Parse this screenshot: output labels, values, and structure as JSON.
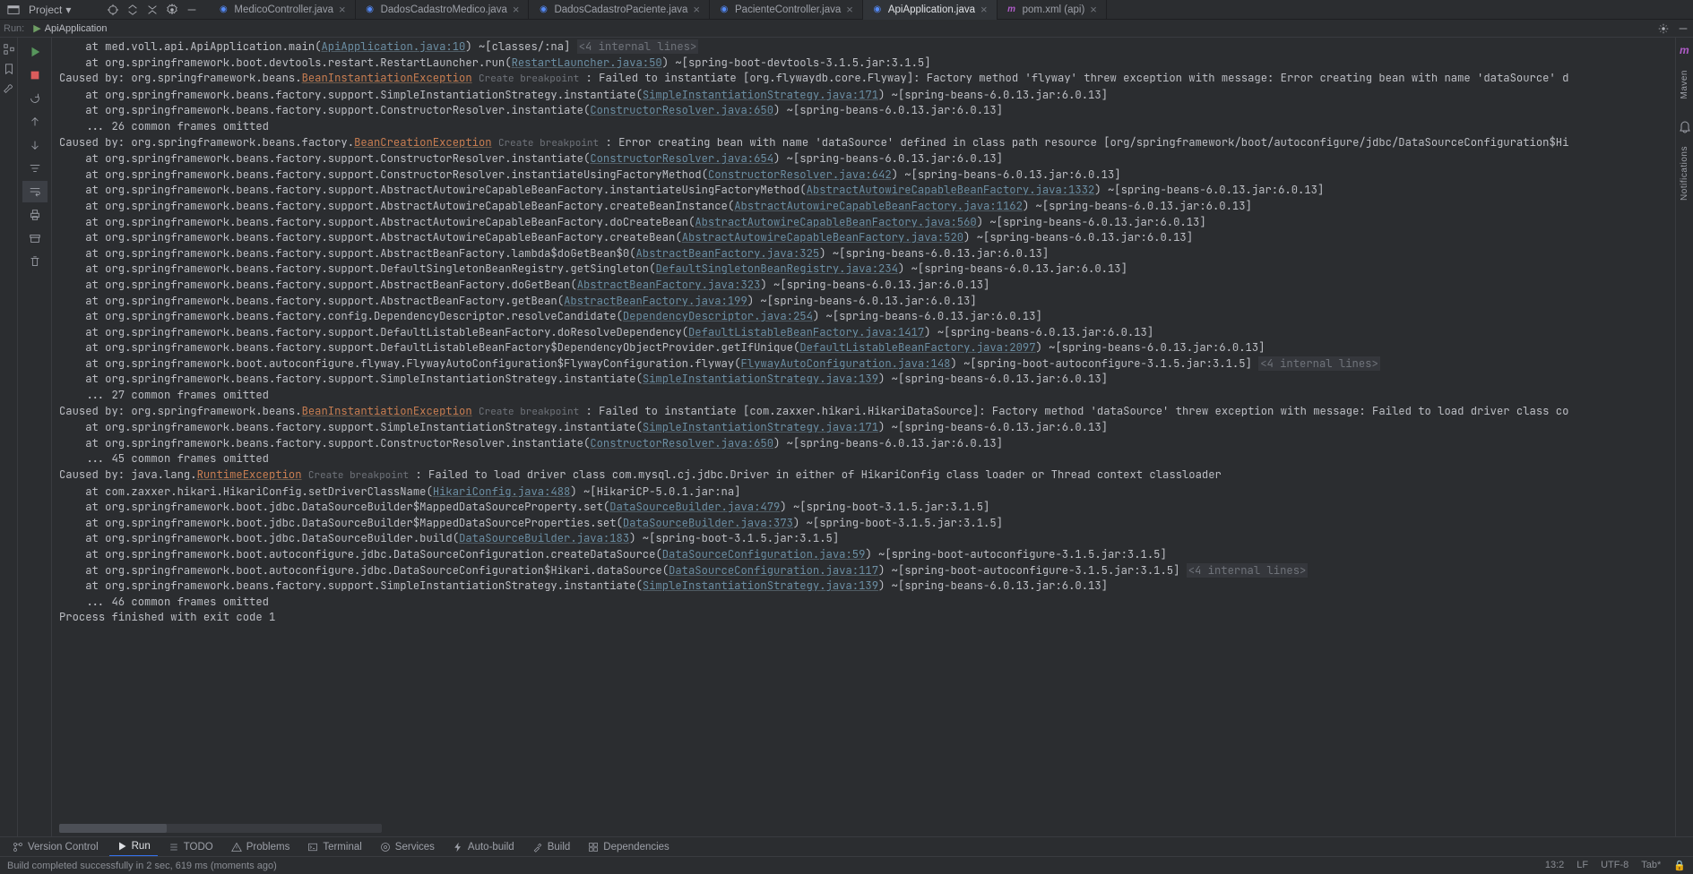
{
  "project_label": "Project",
  "tabs": [
    {
      "label": "MedicoController.java",
      "active": false,
      "icon": "j"
    },
    {
      "label": "DadosCadastroMedico.java",
      "active": false,
      "icon": "j"
    },
    {
      "label": "DadosCadastroPaciente.java",
      "active": false,
      "icon": "j"
    },
    {
      "label": "PacienteController.java",
      "active": false,
      "icon": "j"
    },
    {
      "label": "ApiApplication.java",
      "active": true,
      "icon": "j"
    },
    {
      "label": "pom.xml (api)",
      "active": false,
      "icon": "m"
    }
  ],
  "run_label": "Run:",
  "run_config": "ApiApplication",
  "right_rail": {
    "maven": "Maven",
    "notifications": "Notifications"
  },
  "bottom_tabs": [
    {
      "label": "Version Control",
      "icon": "branch"
    },
    {
      "label": "Run",
      "icon": "play",
      "active": true
    },
    {
      "label": "TODO",
      "icon": "list"
    },
    {
      "label": "Problems",
      "icon": "warn"
    },
    {
      "label": "Terminal",
      "icon": "term"
    },
    {
      "label": "Services",
      "icon": "gear"
    },
    {
      "label": "Auto-build",
      "icon": "bolt"
    },
    {
      "label": "Build",
      "icon": "hammer"
    },
    {
      "label": "Dependencies",
      "icon": "deps"
    }
  ],
  "status": {
    "left": "Build completed successfully in 2 sec, 619 ms (moments ago)",
    "pos": "13:2",
    "lf": "LF",
    "enc": "UTF-8",
    "tab": "Tab*"
  },
  "console_lines": [
    {
      "parts": [
        {
          "t": "    at med.voll.api.ApiApplication.main("
        },
        {
          "t": "ApiApplication.java:10",
          "cls": "lnk"
        },
        {
          "t": ") ~[classes/:na] "
        },
        {
          "t": "<4 internal lines>",
          "cls": "dim"
        }
      ]
    },
    {
      "parts": [
        {
          "t": "    at org.springframework.boot.devtools.restart.RestartLauncher.run("
        },
        {
          "t": "RestartLauncher.java:50",
          "cls": "lnk"
        },
        {
          "t": ") ~[spring-boot-devtools-3.1.5.jar:3.1.5]"
        }
      ]
    },
    {
      "parts": [
        {
          "t": "Caused by: org.springframework.beans."
        },
        {
          "t": "BeanInstantiationException",
          "cls": "exc"
        },
        {
          "t": " "
        },
        {
          "t": "Create breakpoint",
          "cls": "bp"
        },
        {
          "t": " : Failed to instantiate [org.flywaydb.core.Flyway]: Factory method 'flyway' threw exception with message: Error creating bean with name 'dataSource' d"
        }
      ]
    },
    {
      "parts": [
        {
          "t": "    at org.springframework.beans.factory.support.SimpleInstantiationStrategy.instantiate("
        },
        {
          "t": "SimpleInstantiationStrategy.java:171",
          "cls": "lnk"
        },
        {
          "t": ") ~[spring-beans-6.0.13.jar:6.0.13]"
        }
      ]
    },
    {
      "parts": [
        {
          "t": "    at org.springframework.beans.factory.support.ConstructorResolver.instantiate("
        },
        {
          "t": "ConstructorResolver.java:650",
          "cls": "lnk"
        },
        {
          "t": ") ~[spring-beans-6.0.13.jar:6.0.13]"
        }
      ]
    },
    {
      "parts": [
        {
          "t": "    ... 26 common frames omitted"
        }
      ]
    },
    {
      "parts": [
        {
          "t": "Caused by: org.springframework.beans.factory."
        },
        {
          "t": "BeanCreationException",
          "cls": "exc"
        },
        {
          "t": " "
        },
        {
          "t": "Create breakpoint",
          "cls": "bp"
        },
        {
          "t": " : Error creating bean with name 'dataSource' defined in class path resource [org/springframework/boot/autoconfigure/jdbc/DataSourceConfiguration$Hi"
        }
      ]
    },
    {
      "parts": [
        {
          "t": "    at org.springframework.beans.factory.support.ConstructorResolver.instantiate("
        },
        {
          "t": "ConstructorResolver.java:654",
          "cls": "lnk"
        },
        {
          "t": ") ~[spring-beans-6.0.13.jar:6.0.13]"
        }
      ]
    },
    {
      "parts": [
        {
          "t": "    at org.springframework.beans.factory.support.ConstructorResolver.instantiateUsingFactoryMethod("
        },
        {
          "t": "ConstructorResolver.java:642",
          "cls": "lnk"
        },
        {
          "t": ") ~[spring-beans-6.0.13.jar:6.0.13]"
        }
      ]
    },
    {
      "parts": [
        {
          "t": "    at org.springframework.beans.factory.support.AbstractAutowireCapableBeanFactory.instantiateUsingFactoryMethod("
        },
        {
          "t": "AbstractAutowireCapableBeanFactory.java:1332",
          "cls": "lnk"
        },
        {
          "t": ") ~[spring-beans-6.0.13.jar:6.0.13]"
        }
      ]
    },
    {
      "parts": [
        {
          "t": "    at org.springframework.beans.factory.support.AbstractAutowireCapableBeanFactory.createBeanInstance("
        },
        {
          "t": "AbstractAutowireCapableBeanFactory.java:1162",
          "cls": "lnk"
        },
        {
          "t": ") ~[spring-beans-6.0.13.jar:6.0.13]"
        }
      ]
    },
    {
      "parts": [
        {
          "t": "    at org.springframework.beans.factory.support.AbstractAutowireCapableBeanFactory.doCreateBean("
        },
        {
          "t": "AbstractAutowireCapableBeanFactory.java:560",
          "cls": "lnk"
        },
        {
          "t": ") ~[spring-beans-6.0.13.jar:6.0.13]"
        }
      ]
    },
    {
      "parts": [
        {
          "t": "    at org.springframework.beans.factory.support.AbstractAutowireCapableBeanFactory.createBean("
        },
        {
          "t": "AbstractAutowireCapableBeanFactory.java:520",
          "cls": "lnk"
        },
        {
          "t": ") ~[spring-beans-6.0.13.jar:6.0.13]"
        }
      ]
    },
    {
      "parts": [
        {
          "t": "    at org.springframework.beans.factory.support.AbstractBeanFactory.lambda$doGetBean$0("
        },
        {
          "t": "AbstractBeanFactory.java:325",
          "cls": "lnk"
        },
        {
          "t": ") ~[spring-beans-6.0.13.jar:6.0.13]"
        }
      ]
    },
    {
      "parts": [
        {
          "t": "    at org.springframework.beans.factory.support.DefaultSingletonBeanRegistry.getSingleton("
        },
        {
          "t": "DefaultSingletonBeanRegistry.java:234",
          "cls": "lnk"
        },
        {
          "t": ") ~[spring-beans-6.0.13.jar:6.0.13]"
        }
      ]
    },
    {
      "parts": [
        {
          "t": "    at org.springframework.beans.factory.support.AbstractBeanFactory.doGetBean("
        },
        {
          "t": "AbstractBeanFactory.java:323",
          "cls": "lnk"
        },
        {
          "t": ") ~[spring-beans-6.0.13.jar:6.0.13]"
        }
      ]
    },
    {
      "parts": [
        {
          "t": "    at org.springframework.beans.factory.support.AbstractBeanFactory.getBean("
        },
        {
          "t": "AbstractBeanFactory.java:199",
          "cls": "lnk"
        },
        {
          "t": ") ~[spring-beans-6.0.13.jar:6.0.13]"
        }
      ]
    },
    {
      "parts": [
        {
          "t": "    at org.springframework.beans.factory.config.DependencyDescriptor.resolveCandidate("
        },
        {
          "t": "DependencyDescriptor.java:254",
          "cls": "lnk"
        },
        {
          "t": ") ~[spring-beans-6.0.13.jar:6.0.13]"
        }
      ]
    },
    {
      "parts": [
        {
          "t": "    at org.springframework.beans.factory.support.DefaultListableBeanFactory.doResolveDependency("
        },
        {
          "t": "DefaultListableBeanFactory.java:1417",
          "cls": "lnk"
        },
        {
          "t": ") ~[spring-beans-6.0.13.jar:6.0.13]"
        }
      ]
    },
    {
      "parts": [
        {
          "t": "    at org.springframework.beans.factory.support.DefaultListableBeanFactory$DependencyObjectProvider.getIfUnique("
        },
        {
          "t": "DefaultListableBeanFactory.java:2097",
          "cls": "lnk"
        },
        {
          "t": ") ~[spring-beans-6.0.13.jar:6.0.13]"
        }
      ]
    },
    {
      "parts": [
        {
          "t": "    at org.springframework.boot.autoconfigure.flyway.FlywayAutoConfiguration$FlywayConfiguration.flyway("
        },
        {
          "t": "FlywayAutoConfiguration.java:148",
          "cls": "lnk"
        },
        {
          "t": ") ~[spring-boot-autoconfigure-3.1.5.jar:3.1.5] "
        },
        {
          "t": "<4 internal lines>",
          "cls": "dim"
        }
      ]
    },
    {
      "parts": [
        {
          "t": "    at org.springframework.beans.factory.support.SimpleInstantiationStrategy.instantiate("
        },
        {
          "t": "SimpleInstantiationStrategy.java:139",
          "cls": "lnk"
        },
        {
          "t": ") ~[spring-beans-6.0.13.jar:6.0.13]"
        }
      ]
    },
    {
      "parts": [
        {
          "t": "    ... 27 common frames omitted"
        }
      ]
    },
    {
      "parts": [
        {
          "t": "Caused by: org.springframework.beans."
        },
        {
          "t": "BeanInstantiationException",
          "cls": "exc"
        },
        {
          "t": " "
        },
        {
          "t": "Create breakpoint",
          "cls": "bp"
        },
        {
          "t": " : Failed to instantiate [com.zaxxer.hikari.HikariDataSource]: Factory method 'dataSource' threw exception with message: Failed to load driver class co"
        }
      ]
    },
    {
      "parts": [
        {
          "t": "    at org.springframework.beans.factory.support.SimpleInstantiationStrategy.instantiate("
        },
        {
          "t": "SimpleInstantiationStrategy.java:171",
          "cls": "lnk"
        },
        {
          "t": ") ~[spring-beans-6.0.13.jar:6.0.13]"
        }
      ]
    },
    {
      "parts": [
        {
          "t": "    at org.springframework.beans.factory.support.ConstructorResolver.instantiate("
        },
        {
          "t": "ConstructorResolver.java:650",
          "cls": "lnk"
        },
        {
          "t": ") ~[spring-beans-6.0.13.jar:6.0.13]"
        }
      ]
    },
    {
      "parts": [
        {
          "t": "    ... 45 common frames omitted"
        }
      ]
    },
    {
      "parts": [
        {
          "t": "Caused by: java.lang."
        },
        {
          "t": "RuntimeException",
          "cls": "exc"
        },
        {
          "t": " "
        },
        {
          "t": "Create breakpoint",
          "cls": "bp"
        },
        {
          "t": " : Failed to load driver class com.mysql.cj.jdbc.Driver in either of HikariConfig class loader or Thread context classloader"
        }
      ]
    },
    {
      "parts": [
        {
          "t": "    at com.zaxxer.hikari.HikariConfig.setDriverClassName("
        },
        {
          "t": "HikariConfig.java:488",
          "cls": "lnk"
        },
        {
          "t": ") ~[HikariCP-5.0.1.jar:na]"
        }
      ]
    },
    {
      "parts": [
        {
          "t": "    at org.springframework.boot.jdbc.DataSourceBuilder$MappedDataSourceProperty.set("
        },
        {
          "t": "DataSourceBuilder.java:479",
          "cls": "lnk"
        },
        {
          "t": ") ~[spring-boot-3.1.5.jar:3.1.5]"
        }
      ]
    },
    {
      "parts": [
        {
          "t": "    at org.springframework.boot.jdbc.DataSourceBuilder$MappedDataSourceProperties.set("
        },
        {
          "t": "DataSourceBuilder.java:373",
          "cls": "lnk"
        },
        {
          "t": ") ~[spring-boot-3.1.5.jar:3.1.5]"
        }
      ]
    },
    {
      "parts": [
        {
          "t": "    at org.springframework.boot.jdbc.DataSourceBuilder.build("
        },
        {
          "t": "DataSourceBuilder.java:183",
          "cls": "lnk"
        },
        {
          "t": ") ~[spring-boot-3.1.5.jar:3.1.5]"
        }
      ]
    },
    {
      "parts": [
        {
          "t": "    at org.springframework.boot.autoconfigure.jdbc.DataSourceConfiguration.createDataSource("
        },
        {
          "t": "DataSourceConfiguration.java:59",
          "cls": "lnk"
        },
        {
          "t": ") ~[spring-boot-autoconfigure-3.1.5.jar:3.1.5]"
        }
      ]
    },
    {
      "parts": [
        {
          "t": "    at org.springframework.boot.autoconfigure.jdbc.DataSourceConfiguration$Hikari.dataSource("
        },
        {
          "t": "DataSourceConfiguration.java:117",
          "cls": "lnk"
        },
        {
          "t": ") ~[spring-boot-autoconfigure-3.1.5.jar:3.1.5] "
        },
        {
          "t": "<4 internal lines>",
          "cls": "dim"
        }
      ]
    },
    {
      "parts": [
        {
          "t": "    at org.springframework.beans.factory.support.SimpleInstantiationStrategy.instantiate("
        },
        {
          "t": "SimpleInstantiationStrategy.java:139",
          "cls": "lnk"
        },
        {
          "t": ") ~[spring-beans-6.0.13.jar:6.0.13]"
        }
      ]
    },
    {
      "parts": [
        {
          "t": "    ... 46 common frames omitted"
        }
      ]
    },
    {
      "parts": [
        {
          "t": ""
        }
      ]
    },
    {
      "parts": [
        {
          "t": ""
        }
      ]
    },
    {
      "parts": [
        {
          "t": "Process finished with exit code 1"
        }
      ]
    }
  ]
}
